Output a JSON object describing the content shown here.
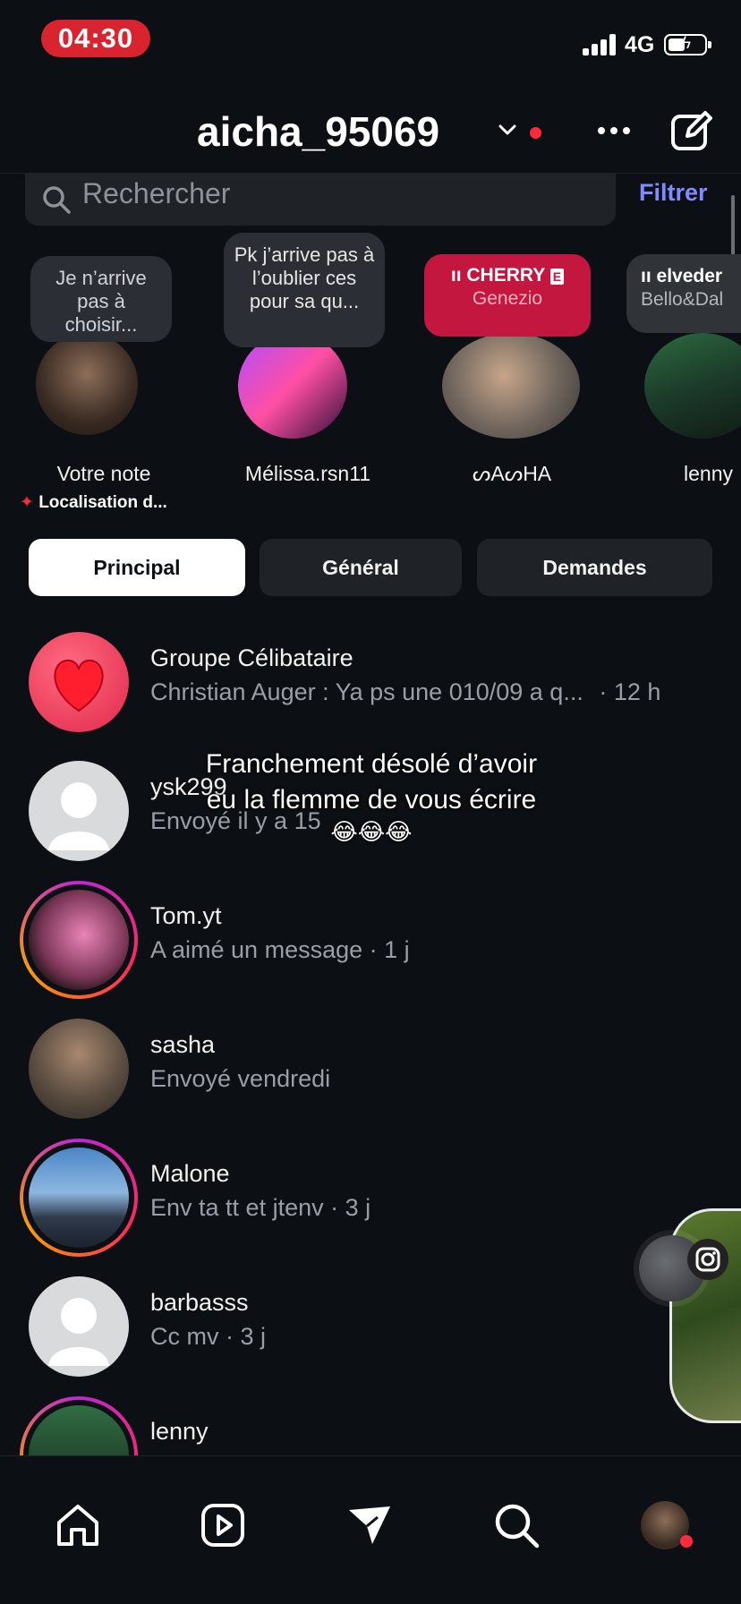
{
  "status_bar": {
    "time": "04:30",
    "network": "4G"
  },
  "header": {
    "username": "aicha_95069"
  },
  "search": {
    "placeholder": "Rechercher",
    "filter_label": "Filtrer"
  },
  "notes": [
    {
      "note": "Je n’arrive pas à choisir...",
      "name": "Votre note",
      "location": "Localisation d..."
    },
    {
      "note": "Pk j’arrive pas à l’oublier ces pour sa qu...",
      "name": "Mélissa.rsn11"
    },
    {
      "music_title": "CHERRY",
      "music_artist": "Genezio",
      "explicit": "E",
      "name": "ᔕAᔕHA"
    },
    {
      "music_title": "elveder",
      "music_artist": "Bello&Dal",
      "name": "lenny"
    }
  ],
  "tabs": {
    "principal": "Principal",
    "general": "Général",
    "demandes": "Demandes"
  },
  "threads": [
    {
      "name": "Groupe Célibataire",
      "preview": "Christian Auger : Ya ps une 010/09 a q...",
      "time": "· 12 h"
    },
    {
      "name": "ysk299",
      "preview": "Envoyé il y a 15"
    },
    {
      "name": "Tom.yt",
      "preview": "A aimé un message · 1 j"
    },
    {
      "name": "sasha",
      "preview": "Envoyé vendredi"
    },
    {
      "name": "Malone",
      "preview": "Env ta tt et jtenv · 3 j"
    },
    {
      "name": "barbasss",
      "preview": "Cc mv · 3 j"
    },
    {
      "name": "lenny",
      "preview": ""
    }
  ],
  "overlay": {
    "line1": "Franchement désolé d’avoir",
    "line2": "eu la flemme de vous écrire",
    "emoji": "😂😂😂"
  },
  "colors": {
    "accent_blue": "#7f8bff",
    "status_red": "#d9232f",
    "music_red": "#c4173f",
    "background": "#0c0f14"
  },
  "icons": [
    "search-icon",
    "chevron-down-icon",
    "more-icon",
    "compose-icon",
    "heart-icon",
    "home-icon",
    "reels-icon",
    "messages-icon",
    "explore-icon",
    "profile-icon",
    "instagram-icon"
  ]
}
